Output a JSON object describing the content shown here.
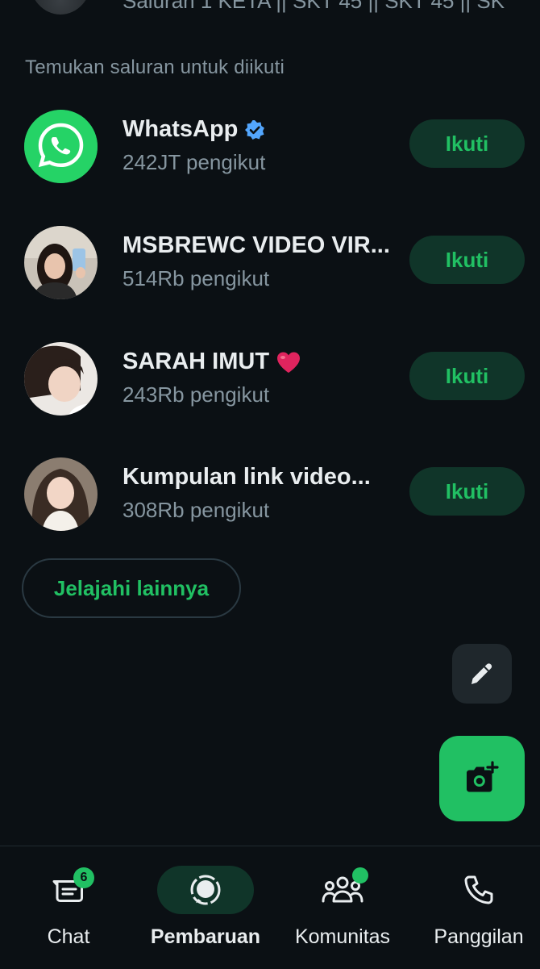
{
  "top_partial": {
    "text": "Saluran 1 KETA || SKT 45 || SKT 45 || SK"
  },
  "section_title": "Temukan saluran untuk diikuti",
  "channels": [
    {
      "name": "WhatsApp",
      "followers": "242JT pengikut",
      "verified": true,
      "follow_label": "Ikuti"
    },
    {
      "name": "MSBREWC VIDEO VIR...",
      "followers": "514Rb pengikut",
      "follow_label": "Ikuti"
    },
    {
      "name": "SARAH IMUT",
      "emoji": "❤️",
      "followers": "243Rb pengikut",
      "follow_label": "Ikuti"
    },
    {
      "name": "Kumpulan link video...",
      "followers": "308Rb pengikut",
      "follow_label": "Ikuti"
    }
  ],
  "explore_label": "Jelajahi lainnya",
  "fab": {
    "small_icon": "pencil-icon",
    "big_icon": "camera-plus-icon"
  },
  "nav": {
    "chat": {
      "label": "Chat",
      "badge": "6",
      "icon": "chat-icon"
    },
    "updates": {
      "label": "Pembaruan",
      "icon": "updates-icon",
      "active": true
    },
    "communities": {
      "label": "Komunitas",
      "icon": "communities-icon",
      "dot": true
    },
    "calls": {
      "label": "Panggilan",
      "icon": "phone-icon"
    }
  },
  "colors": {
    "background": "#0b1014",
    "accent": "#21c063",
    "button_bg": "#103529",
    "secondary_text": "#8696a0"
  }
}
